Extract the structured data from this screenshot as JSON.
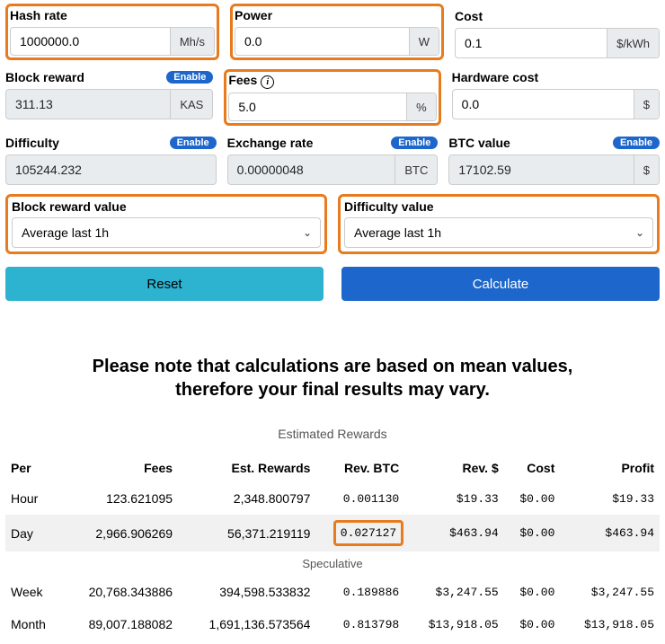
{
  "inputs": {
    "hash_rate": {
      "label": "Hash rate",
      "value": "1000000.0",
      "unit": "Mh/s"
    },
    "power": {
      "label": "Power",
      "value": "0.0",
      "unit": "W"
    },
    "cost": {
      "label": "Cost",
      "value": "0.1",
      "unit": "$/kWh"
    },
    "block_reward": {
      "label": "Block reward",
      "value": "311.13",
      "unit": "KAS",
      "enable": "Enable"
    },
    "fees": {
      "label": "Fees",
      "value": "5.0",
      "unit": "%"
    },
    "hardware_cost": {
      "label": "Hardware cost",
      "value": "0.0",
      "unit": "$"
    },
    "difficulty": {
      "label": "Difficulty",
      "value": "105244.232",
      "enable": "Enable"
    },
    "exchange_rate": {
      "label": "Exchange rate",
      "value": "0.00000048",
      "unit": "BTC",
      "enable": "Enable"
    },
    "btc_value": {
      "label": "BTC value",
      "value": "17102.59",
      "unit": "$",
      "enable": "Enable"
    }
  },
  "selects": {
    "block_reward_value": {
      "label": "Block reward value",
      "selected": "Average last 1h"
    },
    "difficulty_value": {
      "label": "Difficulty value",
      "selected": "Average last 1h"
    }
  },
  "buttons": {
    "reset": "Reset",
    "calculate": "Calculate"
  },
  "note_line1": "Please note that calculations are based on mean values,",
  "note_line2": "therefore your final results may vary.",
  "table": {
    "title": "Estimated Rewards",
    "headers": [
      "Per",
      "Fees",
      "Est. Rewards",
      "Rev. BTC",
      "Rev. $",
      "Cost",
      "Profit"
    ],
    "rows": [
      {
        "per": "Hour",
        "fees": "123.621095",
        "est": "2,348.800797",
        "revbtc": "0.001130",
        "revd": "$19.33",
        "cost": "$0.00",
        "profit": "$19.33"
      },
      {
        "per": "Day",
        "fees": "2,966.906269",
        "est": "56,371.219119",
        "revbtc": "0.027127",
        "revd": "$463.94",
        "cost": "$0.00",
        "profit": "$463.94",
        "zebra": true,
        "hl_revbtc": true
      }
    ],
    "speculative_label": "Speculative",
    "spec_rows": [
      {
        "per": "Week",
        "fees": "20,768.343886",
        "est": "394,598.533832",
        "revbtc": "0.189886",
        "revd": "$3,247.55",
        "cost": "$0.00",
        "profit": "$3,247.55"
      },
      {
        "per": "Month",
        "fees": "89,007.188082",
        "est": "1,691,136.573564",
        "revbtc": "0.813798",
        "revd": "$13,918.05",
        "cost": "$0.00",
        "profit": "$13,918.05"
      }
    ]
  }
}
